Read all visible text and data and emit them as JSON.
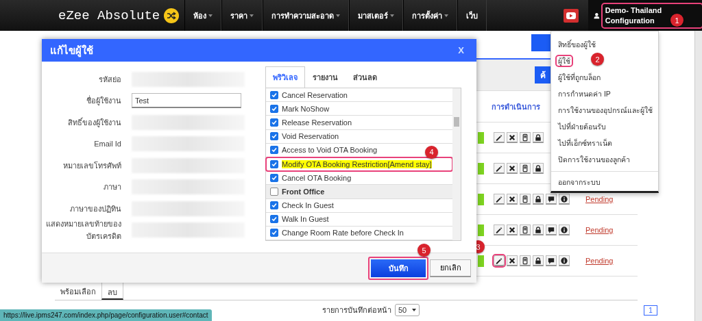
{
  "nav": {
    "logo": "eZee Absolute",
    "menu": [
      {
        "label": "ห้อง",
        "dropdown": true
      },
      {
        "label": "ราคา",
        "dropdown": true
      },
      {
        "label": "การทำความสะอาด",
        "dropdown": true
      },
      {
        "label": "มาสเตอร์",
        "dropdown": true
      },
      {
        "label": "การตั้งค่า",
        "dropdown": true
      },
      {
        "label": "เว็บ",
        "dropdown": false
      }
    ],
    "user": {
      "label": "Demo- Thailand Configuration",
      "highlighted": true,
      "badge": "1"
    }
  },
  "user_menu": {
    "items": [
      {
        "label": "สิทธิ์ของผู้ใช้",
        "highlighted": false
      },
      {
        "label": "ผู้ใช้",
        "highlighted": true,
        "badge": "2"
      },
      {
        "label": "ผู้ใช้ที่ถูกบล็อก",
        "highlighted": false
      },
      {
        "label": "การกำหนดค่า IP",
        "highlighted": false
      },
      {
        "label": "การใช้งานของอุปกรณ์และผู้ใช้",
        "highlighted": false
      },
      {
        "label": "ไปที่ฝ่ายต้อนรับ",
        "highlighted": false
      },
      {
        "label": "ไปที่เอ็กซ์ทราเน็ต",
        "highlighted": false
      },
      {
        "label": "ปิดการใช้งานของลูกค้า",
        "highlighted": false
      }
    ],
    "logout": "ออกจากระบบ"
  },
  "page": {
    "search_button": "ค้",
    "actions_header": "การดำเนินการ",
    "rows": [
      {
        "covered": true,
        "highlighted": false
      },
      {
        "covered": true,
        "highlighted": false
      },
      {
        "covered": false,
        "status": "Pending",
        "highlighted": false
      },
      {
        "covered": false,
        "status": "Pending",
        "highlighted": false
      },
      {
        "covered": false,
        "status": "Pending",
        "highlighted": true,
        "badge": "3"
      }
    ],
    "bottom_tabs": [
      {
        "label": "พร้อมเลือก",
        "selected": false
      },
      {
        "label": "ลบ",
        "selected": true
      }
    ],
    "pagination": {
      "label": "รายการบันทึกต่อหน้า",
      "per_page": "50",
      "page": "1"
    }
  },
  "modal": {
    "title": "แก้ไขผู้ใช้",
    "close": "X",
    "fields": [
      {
        "label": "รหัสย่อ",
        "kind": "blurred"
      },
      {
        "label": "ชื่อผู้ใช้งาน",
        "kind": "text",
        "value": "Test"
      },
      {
        "label": "สิทธิ์ของผู้ใช้งาน",
        "kind": "blurred"
      },
      {
        "label": "Email Id",
        "kind": "blurred"
      },
      {
        "label": "หมายเลขโทรศัพท์",
        "kind": "blurred"
      },
      {
        "label": "ภาษา",
        "kind": "blurred"
      },
      {
        "label": "ภาษาของปฏิทิน",
        "kind": "blurred"
      },
      {
        "label": "แสดงหมายเลขท้ายของบัตรเครดิต",
        "kind": "blurred"
      }
    ],
    "tabs": [
      {
        "label": "พริวิเลจ",
        "selected": true
      },
      {
        "label": "รายงาน",
        "selected": false
      },
      {
        "label": "ส่วนลด",
        "selected": false
      }
    ],
    "privileges": [
      {
        "kind": "item",
        "label": "Cancel Reservation",
        "checked": true,
        "highlighted": false
      },
      {
        "kind": "item",
        "label": "Mark NoShow",
        "checked": true,
        "highlighted": false
      },
      {
        "kind": "item",
        "label": "Release Reservation",
        "checked": true,
        "highlighted": false
      },
      {
        "kind": "item",
        "label": "Void Reservation",
        "checked": true,
        "highlighted": false
      },
      {
        "kind": "item",
        "label": "Access to Void OTA Booking",
        "checked": true,
        "highlighted": false
      },
      {
        "kind": "item",
        "label": "Modify OTA Booking Restriction[Amend stay]",
        "checked": true,
        "highlighted": true,
        "badge": "4"
      },
      {
        "kind": "item",
        "label": "Cancel OTA Booking",
        "checked": true,
        "highlighted": false
      },
      {
        "kind": "group",
        "label": "Front Office",
        "checked": false,
        "highlighted": false
      },
      {
        "kind": "item",
        "label": "Check In Guest",
        "checked": true,
        "highlighted": false
      },
      {
        "kind": "item",
        "label": "Walk In Guest",
        "checked": true,
        "highlighted": false
      },
      {
        "kind": "item",
        "label": "Change Room Rate before Check In",
        "checked": true,
        "highlighted": false
      }
    ],
    "save": {
      "label": "บันทึก",
      "highlighted": true,
      "badge": "5"
    },
    "cancel": "ยกเลิก"
  },
  "status_bar": "https://live.ipms247.com/index.php/page/configuration.user#contact"
}
